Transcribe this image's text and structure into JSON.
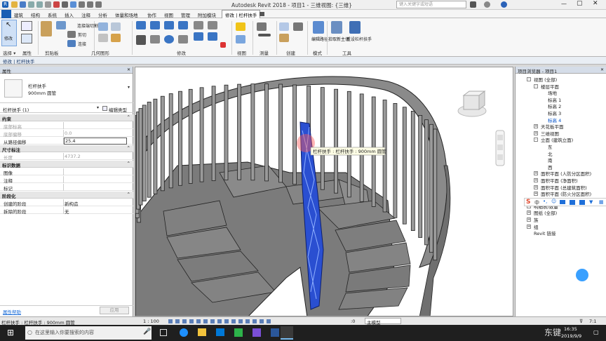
{
  "titlebar": {
    "title": "Autodesk Revit 2018 -     项目1 - 三维视图: {三维}",
    "search_placeholder": "键入关键字或短语"
  },
  "menu": [
    "建筑",
    "结构",
    "系统",
    "插入",
    "注释",
    "分析",
    "体量和场地",
    "协作",
    "视图",
    "管理",
    "附加模块",
    "修改 | 栏杆扶手"
  ],
  "menu_active_index": 11,
  "ribbon": {
    "modify_label": "修改",
    "clipboard_items": [
      "粘贴",
      "剪切",
      "连接"
    ],
    "geometry_items": [
      "连接端切割"
    ],
    "small_labels": [
      "编辑路径",
      "拾取新主体",
      "重设栏杆扶手"
    ],
    "panels": [
      "选择 ▾",
      "属性",
      "剪贴板",
      "几何图形",
      "修改",
      "视图",
      "测量",
      "创建",
      "模式",
      "工具"
    ]
  },
  "context_bar": "修改 | 栏杆扶手",
  "properties": {
    "header": "属性",
    "type_name": "栏杆扶手",
    "type_sub": "900mm 圆管",
    "instance_filter": "栏杆扶手 (1)",
    "edit_type": "编辑类型",
    "rows": [
      {
        "cat": "约束"
      },
      {
        "k": "底部标高",
        "v": "",
        "grey": true
      },
      {
        "k": "底部偏移",
        "v": "0.0",
        "grey": true
      },
      {
        "k": "从路径偏移",
        "v": "25.4",
        "grey": false
      },
      {
        "cat": "尺寸标注"
      },
      {
        "k": "长度",
        "v": "4737.2",
        "grey": true
      },
      {
        "cat": "标识数据"
      },
      {
        "k": "图像",
        "v": "",
        "grey": false
      },
      {
        "k": "注释",
        "v": "",
        "grey": false
      },
      {
        "k": "标记",
        "v": "",
        "grey": false
      },
      {
        "cat": "阶段化"
      },
      {
        "k": "创建的阶段",
        "v": "新构造",
        "grey": false
      },
      {
        "k": "拆除的阶段",
        "v": "无",
        "grey": false
      }
    ],
    "help": "属性帮助",
    "apply": "应用"
  },
  "canvas": {
    "tooltip": "栏杆扶手 : 栏杆扶手 : 900mm 圆管",
    "scale": "1 : 100"
  },
  "browser": {
    "header": "项目浏览器 - 项目1",
    "items": [
      {
        "t": "视图 (全部)",
        "lvl": 0,
        "tog": "-"
      },
      {
        "t": "楼层平面",
        "lvl": 1,
        "tog": "-"
      },
      {
        "t": "场地",
        "lvl": 2
      },
      {
        "t": "标高 1",
        "lvl": 2
      },
      {
        "t": "标高 2",
        "lvl": 2
      },
      {
        "t": "标高 3",
        "lvl": 2
      },
      {
        "t": "标高 4",
        "lvl": 2
      },
      {
        "t": "天花板平面",
        "lvl": 1,
        "tog": "+"
      },
      {
        "t": "三维视图",
        "lvl": 1,
        "tog": "+"
      },
      {
        "t": "立面 (建筑立面)",
        "lvl": 1,
        "tog": "-"
      },
      {
        "t": "东",
        "lvl": 2
      },
      {
        "t": "北",
        "lvl": 2
      },
      {
        "t": "南",
        "lvl": 2
      },
      {
        "t": "西",
        "lvl": 2
      },
      {
        "t": "面积平面 (人防分区面积)",
        "lvl": 1,
        "tog": "+"
      },
      {
        "t": "面积平面 (净面积)",
        "lvl": 1,
        "tog": "+"
      },
      {
        "t": "面积平面 (总建筑面积)",
        "lvl": 1,
        "tog": "+"
      },
      {
        "t": "面积平面 (防火分区面积)",
        "lvl": 1,
        "tog": "+"
      },
      {
        "t": "",
        "lvl": 0
      },
      {
        "t": "明细表/数量",
        "lvl": 0,
        "tog": "+"
      },
      {
        "t": "图纸 (全部)",
        "lvl": 0,
        "tog": "+"
      },
      {
        "t": "族",
        "lvl": 0,
        "tog": "+"
      },
      {
        "t": "组",
        "lvl": 0,
        "tog": "+"
      },
      {
        "t": "Revit 链接",
        "lvl": 0
      }
    ]
  },
  "statusbar": {
    "text": "栏杆扶手 : 栏杆扶手 : 900mm 圆管",
    "filter": ":0",
    "model": "主模型",
    "mode": "7:1"
  },
  "taskbar": {
    "search_placeholder": "在这里输入你要搜索的内容",
    "time": "16:35",
    "date": "2019/9/9",
    "watermark": "东键"
  },
  "colors": {
    "accent": "#1e6fd9",
    "railing_selected": "#2a4fd1",
    "stair_grey": "#7d7d7d"
  }
}
